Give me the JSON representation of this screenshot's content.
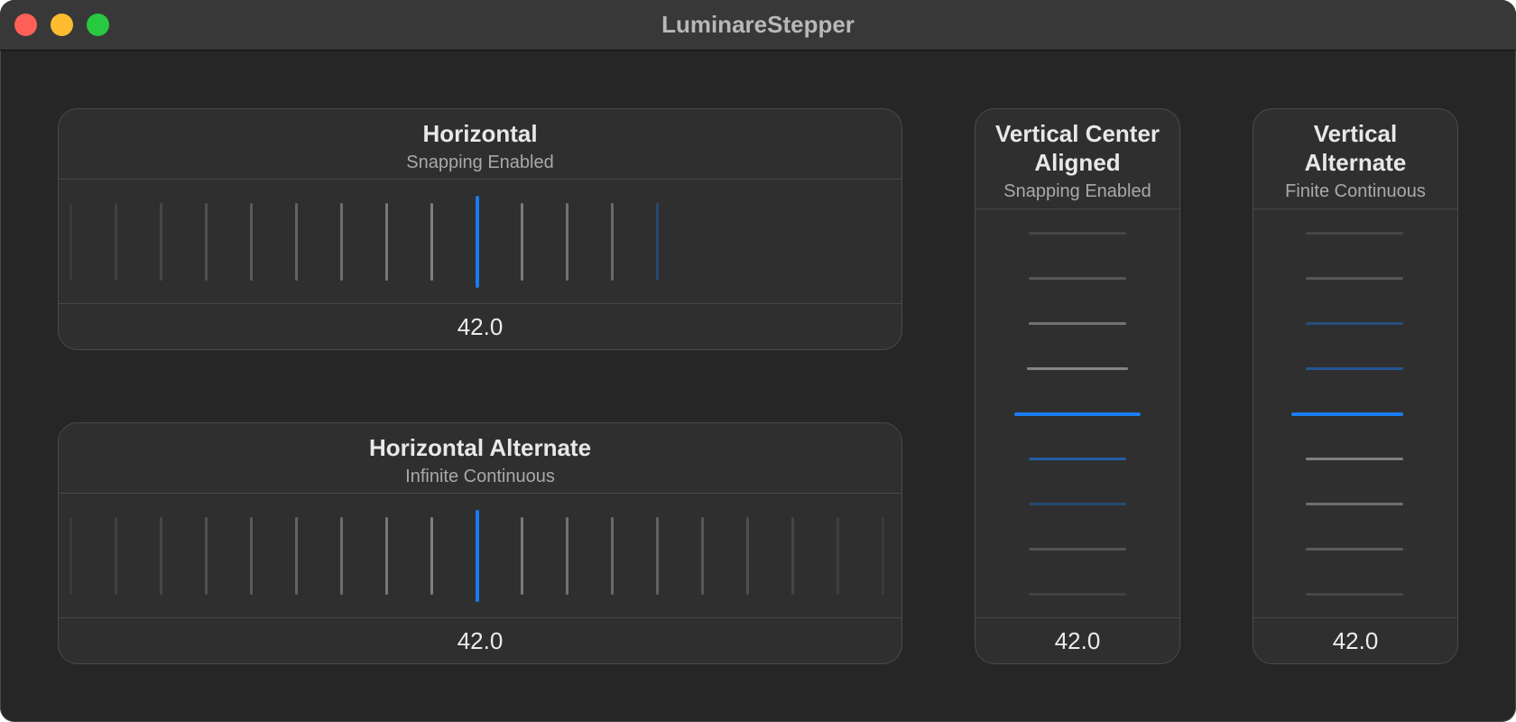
{
  "window": {
    "title": "LuminareStepper"
  },
  "accent_color": "#1a7cf0",
  "steppers": {
    "horizontal": {
      "title": "Horizontal",
      "subtitle": "Snapping Enabled",
      "value": "42.0",
      "orientation": "horizontal",
      "ticks": [
        {
          "c": "gray",
          "o": 0.12
        },
        {
          "c": "gray",
          "o": 0.2
        },
        {
          "c": "gray",
          "o": 0.28
        },
        {
          "c": "gray",
          "o": 0.38
        },
        {
          "c": "gray",
          "o": 0.48
        },
        {
          "c": "gray",
          "o": 0.58
        },
        {
          "c": "gray",
          "o": 0.68
        },
        {
          "c": "gray",
          "o": 0.8
        },
        {
          "c": "gray",
          "o": 0.9
        },
        {
          "c": "accent",
          "o": 1
        },
        {
          "c": "gray",
          "o": 0.85
        },
        {
          "c": "gray",
          "o": 0.75
        },
        {
          "c": "gray",
          "o": 0.65
        },
        {
          "c": "accent",
          "o": 0.35
        }
      ]
    },
    "horizontal_alternate": {
      "title": "Horizontal Alternate",
      "subtitle": "Infinite Continuous",
      "value": "42.0",
      "orientation": "horizontal",
      "ticks": [
        {
          "c": "gray",
          "o": 0.12
        },
        {
          "c": "gray",
          "o": 0.2
        },
        {
          "c": "gray",
          "o": 0.28
        },
        {
          "c": "gray",
          "o": 0.38
        },
        {
          "c": "gray",
          "o": 0.48
        },
        {
          "c": "gray",
          "o": 0.58
        },
        {
          "c": "gray",
          "o": 0.68
        },
        {
          "c": "gray",
          "o": 0.8
        },
        {
          "c": "gray",
          "o": 0.9
        },
        {
          "c": "accent",
          "o": 1
        },
        {
          "c": "gray",
          "o": 0.85
        },
        {
          "c": "gray",
          "o": 0.75
        },
        {
          "c": "gray",
          "o": 0.65
        },
        {
          "c": "gray",
          "o": 0.55
        },
        {
          "c": "gray",
          "o": 0.45
        },
        {
          "c": "gray",
          "o": 0.35
        },
        {
          "c": "gray",
          "o": 0.25
        },
        {
          "c": "gray",
          "o": 0.18
        },
        {
          "c": "gray",
          "o": 0.12
        }
      ]
    },
    "vertical_center": {
      "title": "Vertical Center Aligned",
      "subtitle": "Snapping Enabled",
      "value": "42.0",
      "orientation": "vertical",
      "ticks": [
        {
          "c": "gray",
          "o": 0.25
        },
        {
          "c": "gray",
          "o": 0.45
        },
        {
          "c": "gray",
          "o": 0.75
        },
        {
          "c": "gray",
          "o": 0.95
        },
        {
          "c": "accent",
          "o": 1
        },
        {
          "c": "accent",
          "o": 0.6
        },
        {
          "c": "accent",
          "o": 0.35
        },
        {
          "c": "gray",
          "o": 0.4
        },
        {
          "c": "gray",
          "o": 0.2
        }
      ]
    },
    "vertical_alternate": {
      "title": "Vertical Alternate",
      "subtitle": "Finite Continuous",
      "value": "42.0",
      "orientation": "vertical",
      "ticks": [
        {
          "c": "gray",
          "o": 0.25
        },
        {
          "c": "gray",
          "o": 0.45
        },
        {
          "c": "accent",
          "o": 0.4
        },
        {
          "c": "accent",
          "o": 0.5
        },
        {
          "c": "accent",
          "o": 1
        },
        {
          "c": "gray",
          "o": 0.9
        },
        {
          "c": "gray",
          "o": 0.7
        },
        {
          "c": "gray",
          "o": 0.5
        },
        {
          "c": "gray",
          "o": 0.25
        }
      ]
    }
  }
}
